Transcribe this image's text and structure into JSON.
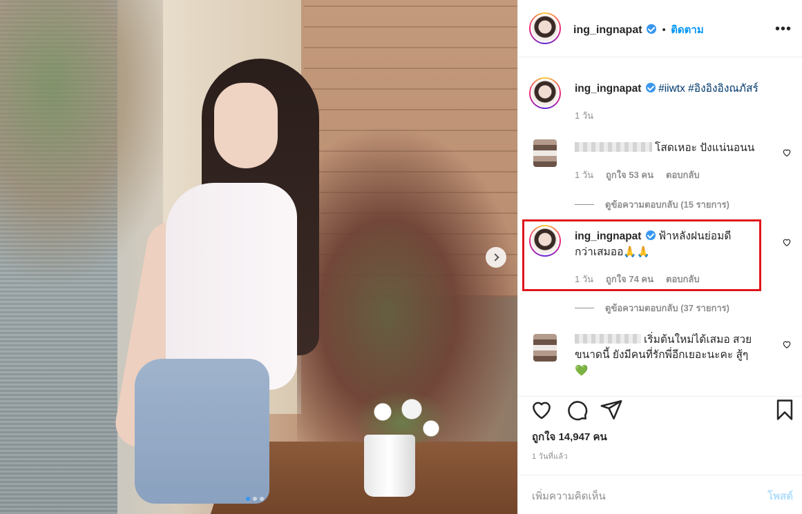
{
  "post": {
    "username": "ing_ingnapat",
    "follow_label": "ติดตาม",
    "bullet": "•",
    "more_label": "•••"
  },
  "caption": {
    "username": "ing_ingnapat",
    "hashtag1": "#iiwtx",
    "hashtag2": "#อิงอิงอิงณภัสร์",
    "time": "1 วัน"
  },
  "comments": [
    {
      "text": "โสดเหอะ ปังแน่นอนน",
      "time": "1 วัน",
      "likes": "ถูกใจ 53 คน",
      "reply_label": "ตอบกลับ",
      "view_replies": "ดูข้อความตอบกลับ (15 รายการ)"
    },
    {
      "username": "ing_ingnapat",
      "text": "ฟ้าหลังฝนย่อมดีกว่าเสมออ",
      "emoji": "🙏🙏",
      "time": "1 วัน",
      "likes": "ถูกใจ 74 คน",
      "reply_label": "ตอบกลับ",
      "view_replies": "ดูข้อความตอบกลับ (37 รายการ)"
    },
    {
      "text": "เริ่มต้นใหม่ได้เสมอ สวยขนาดนี้ ยังมีคนที่รักพี่อีกเยอะนะคะ สู้ๆ",
      "emoji": "💚"
    }
  ],
  "actions": {
    "likes": "ถูกใจ 14,947 คน",
    "time": "1 วันที่แล้ว"
  },
  "add_comment": {
    "placeholder": "เพิ่มความคิดเห็น",
    "post_label": "โพสต์"
  },
  "carousel": {
    "total": 3,
    "active": 1
  },
  "colors": {
    "accent": "#0095f6",
    "highlight": "#e0141b",
    "verified": "#3897f0"
  }
}
